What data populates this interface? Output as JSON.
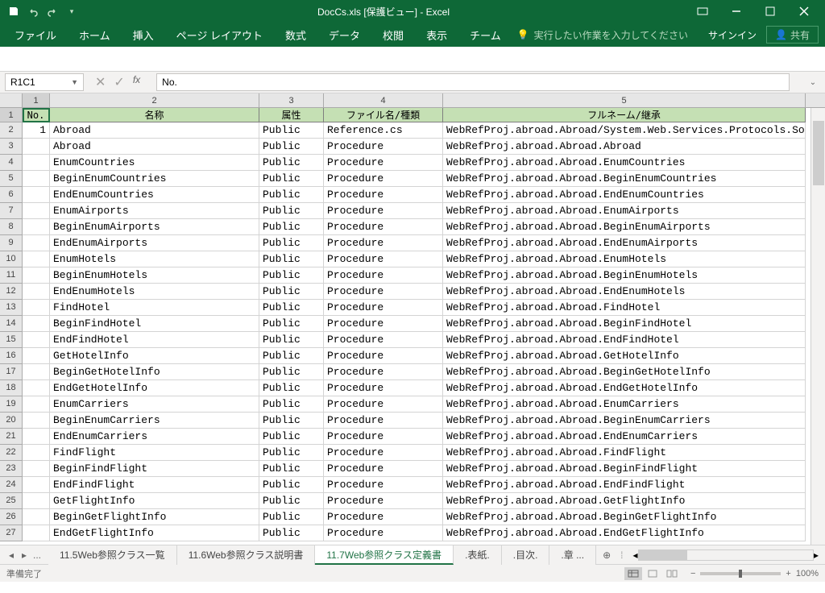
{
  "title": "DocCs.xls  [保護ビュー] - Excel",
  "qat": {
    "save": "save",
    "undo": "undo",
    "redo": "redo",
    "custom": "▾"
  },
  "ribbon": [
    "ファイル",
    "ホーム",
    "挿入",
    "ページ レイアウト",
    "数式",
    "データ",
    "校閲",
    "表示",
    "チーム"
  ],
  "tellme": "実行したい作業を入力してください",
  "signin": "サインイン",
  "share": "共有",
  "namebox": "R1C1",
  "formula": "No.",
  "col_numbers": [
    "1",
    "2",
    "3",
    "4",
    "5"
  ],
  "headers": {
    "c1": "No.",
    "c2": "名称",
    "c3": "属性",
    "c4": "ファイル名/種類",
    "c5": "フルネーム/継承"
  },
  "rows": [
    {
      "n": "1",
      "name": "Abroad",
      "attr": "Public",
      "file": "Reference.cs",
      "full": "WebRefProj.abroad.Abroad/System.Web.Services.Protocols.So"
    },
    {
      "n": "",
      "name": "Abroad",
      "attr": "Public",
      "file": "Procedure",
      "full": "WebRefProj.abroad.Abroad.Abroad"
    },
    {
      "n": "",
      "name": "EnumCountries",
      "attr": "Public",
      "file": "Procedure",
      "full": "WebRefProj.abroad.Abroad.EnumCountries"
    },
    {
      "n": "",
      "name": "BeginEnumCountries",
      "attr": "Public",
      "file": "Procedure",
      "full": "WebRefProj.abroad.Abroad.BeginEnumCountries"
    },
    {
      "n": "",
      "name": "EndEnumCountries",
      "attr": "Public",
      "file": "Procedure",
      "full": "WebRefProj.abroad.Abroad.EndEnumCountries"
    },
    {
      "n": "",
      "name": "EnumAirports",
      "attr": "Public",
      "file": "Procedure",
      "full": "WebRefProj.abroad.Abroad.EnumAirports"
    },
    {
      "n": "",
      "name": "BeginEnumAirports",
      "attr": "Public",
      "file": "Procedure",
      "full": "WebRefProj.abroad.Abroad.BeginEnumAirports"
    },
    {
      "n": "",
      "name": "EndEnumAirports",
      "attr": "Public",
      "file": "Procedure",
      "full": "WebRefProj.abroad.Abroad.EndEnumAirports"
    },
    {
      "n": "",
      "name": "EnumHotels",
      "attr": "Public",
      "file": "Procedure",
      "full": "WebRefProj.abroad.Abroad.EnumHotels"
    },
    {
      "n": "",
      "name": "BeginEnumHotels",
      "attr": "Public",
      "file": "Procedure",
      "full": "WebRefProj.abroad.Abroad.BeginEnumHotels"
    },
    {
      "n": "",
      "name": "EndEnumHotels",
      "attr": "Public",
      "file": "Procedure",
      "full": "WebRefProj.abroad.Abroad.EndEnumHotels"
    },
    {
      "n": "",
      "name": "FindHotel",
      "attr": "Public",
      "file": "Procedure",
      "full": "WebRefProj.abroad.Abroad.FindHotel"
    },
    {
      "n": "",
      "name": "BeginFindHotel",
      "attr": "Public",
      "file": "Procedure",
      "full": "WebRefProj.abroad.Abroad.BeginFindHotel"
    },
    {
      "n": "",
      "name": "EndFindHotel",
      "attr": "Public",
      "file": "Procedure",
      "full": "WebRefProj.abroad.Abroad.EndFindHotel"
    },
    {
      "n": "",
      "name": "GetHotelInfo",
      "attr": "Public",
      "file": "Procedure",
      "full": "WebRefProj.abroad.Abroad.GetHotelInfo"
    },
    {
      "n": "",
      "name": "BeginGetHotelInfo",
      "attr": "Public",
      "file": "Procedure",
      "full": "WebRefProj.abroad.Abroad.BeginGetHotelInfo"
    },
    {
      "n": "",
      "name": "EndGetHotelInfo",
      "attr": "Public",
      "file": "Procedure",
      "full": "WebRefProj.abroad.Abroad.EndGetHotelInfo"
    },
    {
      "n": "",
      "name": "EnumCarriers",
      "attr": "Public",
      "file": "Procedure",
      "full": "WebRefProj.abroad.Abroad.EnumCarriers"
    },
    {
      "n": "",
      "name": "BeginEnumCarriers",
      "attr": "Public",
      "file": "Procedure",
      "full": "WebRefProj.abroad.Abroad.BeginEnumCarriers"
    },
    {
      "n": "",
      "name": "EndEnumCarriers",
      "attr": "Public",
      "file": "Procedure",
      "full": "WebRefProj.abroad.Abroad.EndEnumCarriers"
    },
    {
      "n": "",
      "name": "FindFlight",
      "attr": "Public",
      "file": "Procedure",
      "full": "WebRefProj.abroad.Abroad.FindFlight"
    },
    {
      "n": "",
      "name": "BeginFindFlight",
      "attr": "Public",
      "file": "Procedure",
      "full": "WebRefProj.abroad.Abroad.BeginFindFlight"
    },
    {
      "n": "",
      "name": "EndFindFlight",
      "attr": "Public",
      "file": "Procedure",
      "full": "WebRefProj.abroad.Abroad.EndFindFlight"
    },
    {
      "n": "",
      "name": "GetFlightInfo",
      "attr": "Public",
      "file": "Procedure",
      "full": "WebRefProj.abroad.Abroad.GetFlightInfo"
    },
    {
      "n": "",
      "name": "BeginGetFlightInfo",
      "attr": "Public",
      "file": "Procedure",
      "full": "WebRefProj.abroad.Abroad.BeginGetFlightInfo"
    },
    {
      "n": "",
      "name": "EndGetFlightInfo",
      "attr": "Public",
      "file": "Procedure",
      "full": "WebRefProj.abroad.Abroad.EndGetFlightInfo"
    }
  ],
  "sheets": {
    "prev": "...",
    "list": [
      "11.5Web参照クラス一覧",
      "11.6Web参照クラス説明書",
      "11.7Web参照クラス定義書",
      ".表紙.",
      ".目次.",
      ".章 ..."
    ],
    "active": 2,
    "add": "⊕"
  },
  "status": "準備完了",
  "zoom": "100%"
}
